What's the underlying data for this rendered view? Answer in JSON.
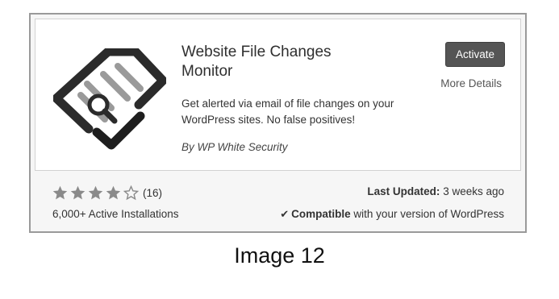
{
  "plugin": {
    "name": "Website File Changes Monitor",
    "description": "Get alerted via email of file changes on your WordPress sites. No false positives!",
    "author": "By WP White Security",
    "icon": "file-search-check-icon"
  },
  "actions": {
    "activate_label": "Activate",
    "more_details_label": "More Details"
  },
  "rating": {
    "stars": 4,
    "max_stars": 5,
    "count_label": "(16)"
  },
  "stats": {
    "installs": "6,000+ Active Installations",
    "last_updated_label": "Last Updated:",
    "last_updated_value": "3 weeks ago",
    "compatible_label": "Compatible",
    "compatible_rest": "with your version of WordPress"
  },
  "caption": "Image 12",
  "colors": {
    "button_bg": "#555555",
    "star_fill": "#8a8a8a"
  }
}
